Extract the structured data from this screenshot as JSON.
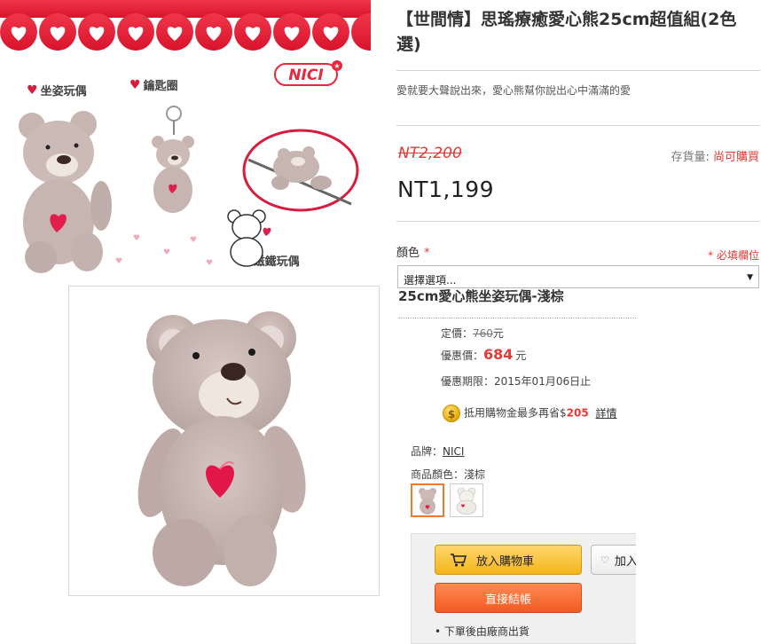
{
  "banner": {
    "brand_logo_text": "NICI",
    "label_sitting_doll": "坐姿玩偶",
    "label_keychain": "鑰匙圈",
    "label_magnet_doll": "磁鐵玩偶"
  },
  "product": {
    "title": "【世間情】思瑤療癒愛心熊25cm超值組(2色選)",
    "subtitle": "愛就要大聲說出來，愛心熊幫你說出心中滿滿的愛",
    "original_price": "NT2,200",
    "price": "NT1,199",
    "stock_label": "存貨量:",
    "stock_value": "尚可購買"
  },
  "options": {
    "color_label": "顏色",
    "required_mark": "*",
    "required_note": "* 必填欄位",
    "select_placeholder": "選擇選項...",
    "variant_title": "25cm愛心熊坐姿玩偶-淺棕"
  },
  "variant": {
    "list_price_label": "定價：",
    "list_price_value": "760",
    "list_price_unit": "元",
    "sale_price_label": "優惠價：",
    "sale_price_value": "684",
    "sale_price_unit": "元",
    "deadline_label": "優惠期限：",
    "deadline_value": "2015年01月06日止",
    "coin_symbol": "$",
    "credit_text": "抵用購物金最多再省$",
    "credit_amount": "205",
    "credit_link": "詳情",
    "brand_label": "品牌：",
    "brand_value": "NICI",
    "color_field_label": "商品顏色：",
    "color_field_value": "淺棕"
  },
  "actions": {
    "add_to_cart": "放入購物車",
    "add_favorite": "加入",
    "checkout": "直接結帳",
    "ship_note": "• 下單後由廠商出貨"
  },
  "colors": {
    "accent_red": "#e53935",
    "checkout_orange": "#f25a22",
    "cart_yellow": "#f5b41c",
    "banner_red": "#e8283c",
    "bear_beige": "#c6b5b1"
  }
}
